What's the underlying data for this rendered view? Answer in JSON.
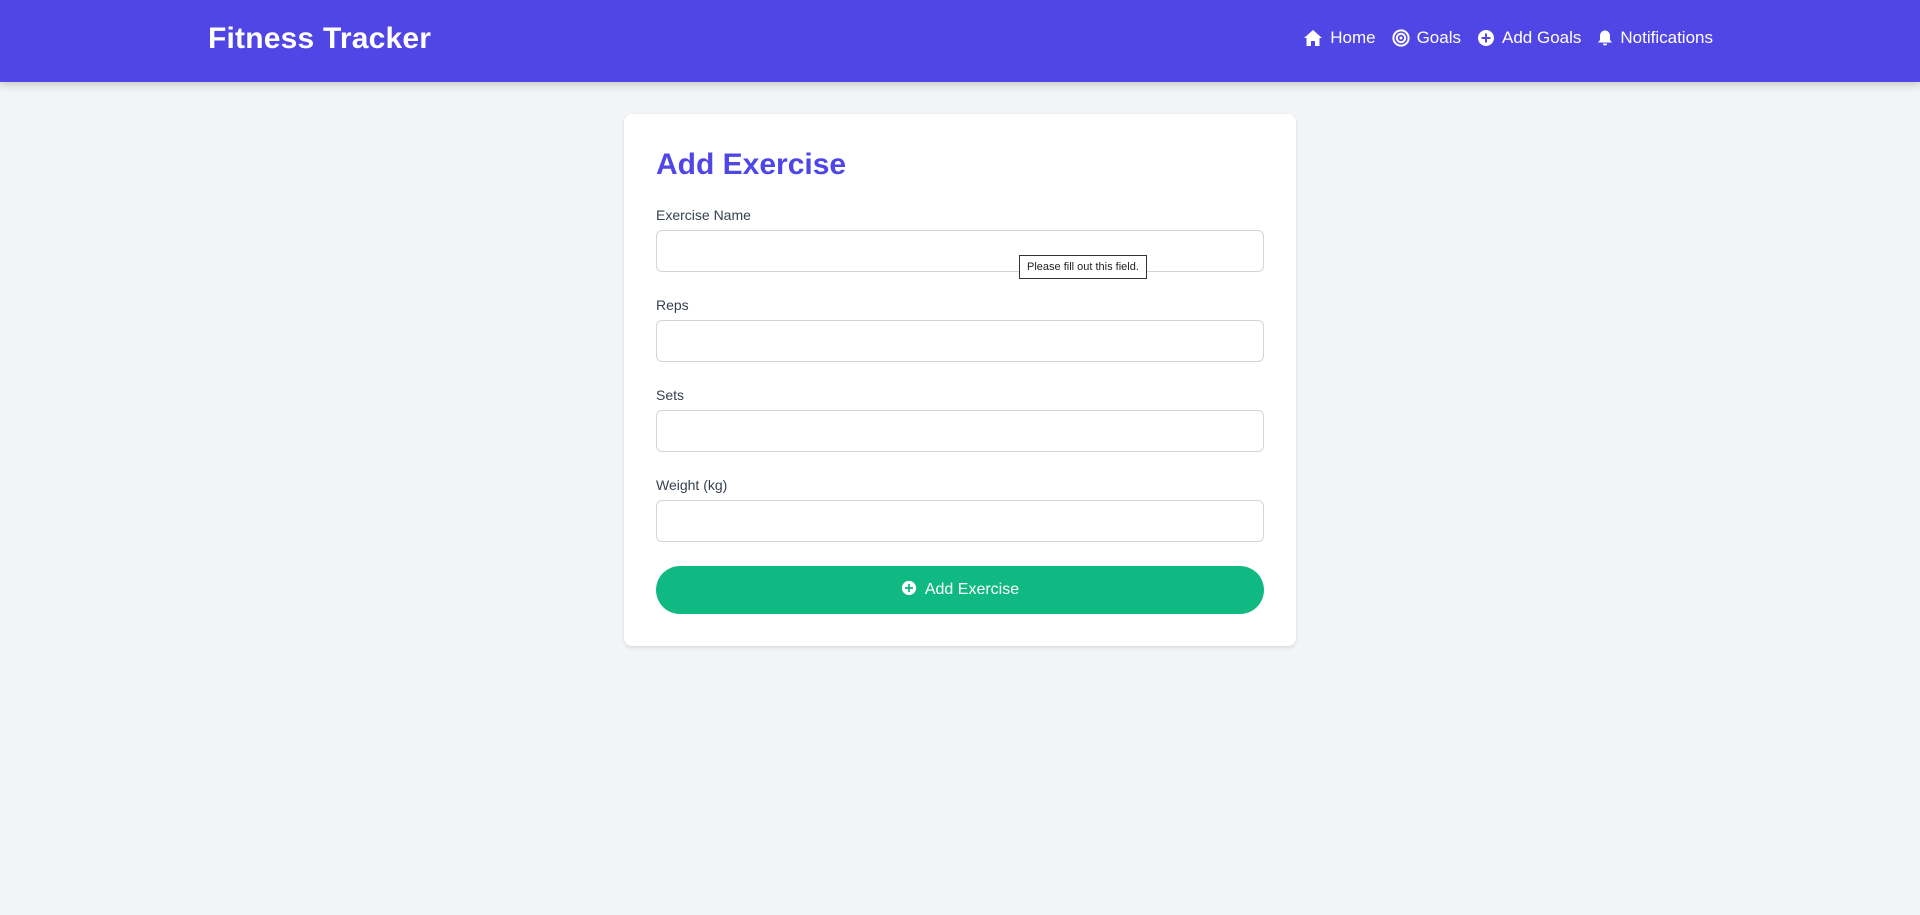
{
  "header": {
    "brand": "Fitness Tracker",
    "nav": [
      {
        "label": "Home",
        "icon": "home-icon"
      },
      {
        "label": "Goals",
        "icon": "target-icon"
      },
      {
        "label": "Add Goals",
        "icon": "plus-circle-icon"
      },
      {
        "label": "Notifications",
        "icon": "bell-icon"
      }
    ]
  },
  "form": {
    "title": "Add Exercise",
    "fields": [
      {
        "label": "Exercise Name",
        "value": "",
        "placeholder": ""
      },
      {
        "label": "Reps",
        "value": "",
        "placeholder": ""
      },
      {
        "label": "Sets",
        "value": "",
        "placeholder": ""
      },
      {
        "label": "Weight (kg)",
        "value": "",
        "placeholder": ""
      }
    ],
    "submit_label": "Add Exercise",
    "submit_icon": "plus-circle-icon",
    "validation_message": "Please fill out this field."
  },
  "colors": {
    "header_bg": "#4f46e5",
    "title": "#4f46e5",
    "button_bg": "#10b981",
    "page_bg": "#f3f4f6"
  }
}
